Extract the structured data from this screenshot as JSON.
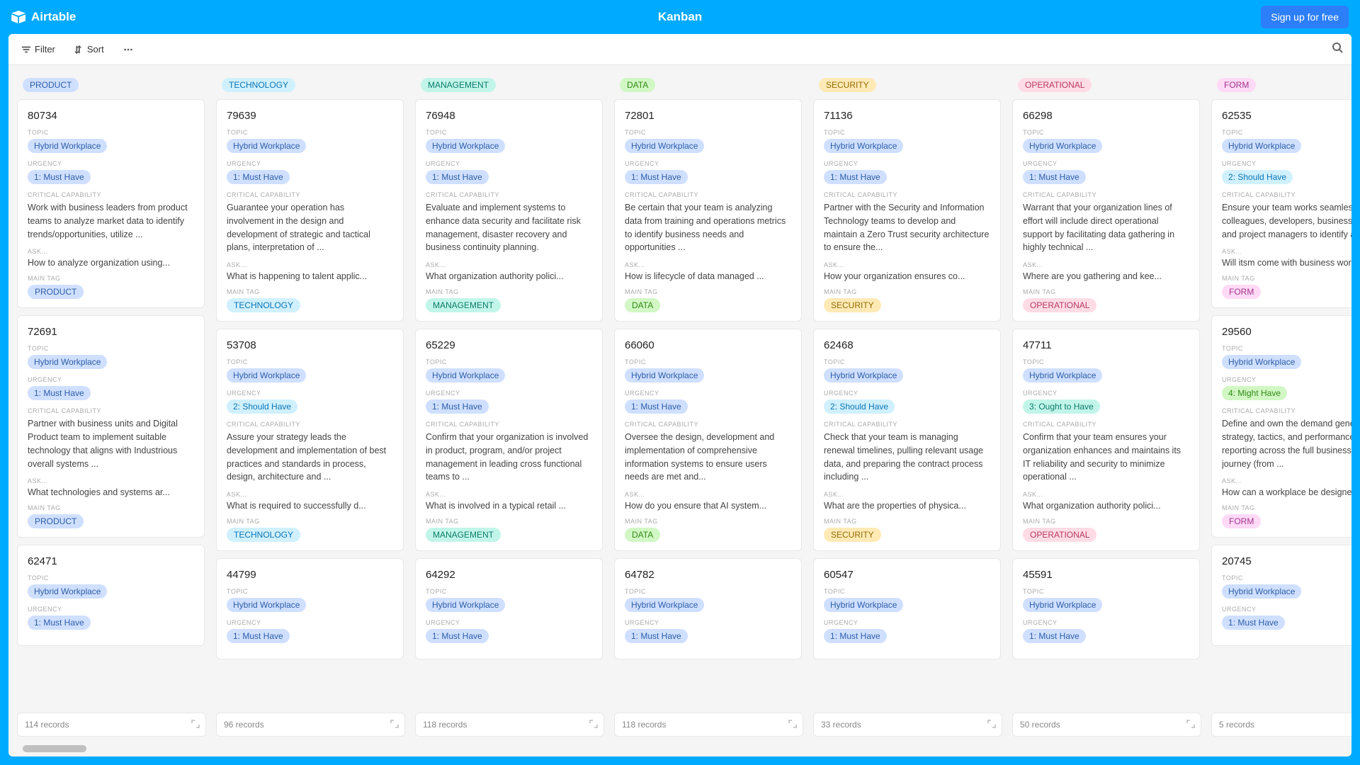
{
  "header": {
    "brand": "Airtable",
    "title": "Kanban",
    "signup": "Sign up for free"
  },
  "toolbar": {
    "filter": "Filter",
    "sort": "Sort"
  },
  "labels": {
    "topic": "TOPIC",
    "urgency": "URGENCY",
    "critical": "CRITICAL CAPABILITY",
    "ask": "ASK...",
    "maintag": "MAIN TAG"
  },
  "urgency": {
    "1": "1: Must Have",
    "2": "2: Should Have",
    "3": "3: Ought to Have",
    "4": "4: Might Have"
  },
  "columns": [
    {
      "name": "PRODUCT",
      "cls": "product",
      "records": "114 records",
      "cards": [
        {
          "id": "80734",
          "topic": "Hybrid Workplace",
          "urg": "1",
          "desc": "Work with business leaders from product teams to analyze market data to identify trends/opportunities, utilize ...",
          "ask": "How to analyze organization using..."
        },
        {
          "id": "72691",
          "topic": "Hybrid Workplace",
          "urg": "1",
          "desc": "Partner with business units and Digital Product team to implement suitable technology that aligns with Industrious overall systems ...",
          "ask": "What technologies and systems ar..."
        },
        {
          "id": "62471",
          "topic": "Hybrid Workplace",
          "urg": "1",
          "desc": "",
          "ask": ""
        }
      ]
    },
    {
      "name": "TECHNOLOGY",
      "cls": "technology",
      "records": "96 records",
      "cards": [
        {
          "id": "79639",
          "topic": "Hybrid Workplace",
          "urg": "1",
          "desc": "Guarantee your operation has involvement in the design and development of strategic and tactical plans, interpretation of ...",
          "ask": "What is happening to talent applic..."
        },
        {
          "id": "53708",
          "topic": "Hybrid Workplace",
          "urg": "2",
          "desc": "Assure your strategy leads the development and implementation of best practices and standards in process, design, architecture and ...",
          "ask": "What is required to successfully d..."
        },
        {
          "id": "44799",
          "topic": "Hybrid Workplace",
          "urg": "1",
          "desc": "",
          "ask": ""
        }
      ]
    },
    {
      "name": "MANAGEMENT",
      "cls": "management",
      "records": "118 records",
      "cards": [
        {
          "id": "76948",
          "topic": "Hybrid Workplace",
          "urg": "1",
          "desc": "Evaluate and implement systems to enhance data security and facilitate risk management, disaster recovery and business continuity planning.",
          "ask": "What organization authority polici..."
        },
        {
          "id": "65229",
          "topic": "Hybrid Workplace",
          "urg": "1",
          "desc": "Confirm that your organization is involved in product, program, and/or project management in leading cross functional teams to ...",
          "ask": "What is involved in a typical retail ..."
        },
        {
          "id": "64292",
          "topic": "Hybrid Workplace",
          "urg": "1",
          "desc": "",
          "ask": ""
        }
      ]
    },
    {
      "name": "DATA",
      "cls": "data",
      "records": "118 records",
      "cards": [
        {
          "id": "72801",
          "topic": "Hybrid Workplace",
          "urg": "1",
          "desc": "Be certain that your team is analyzing data from training and operations metrics to identify business needs and opportunities ...",
          "ask": "How is lifecycle of data managed ..."
        },
        {
          "id": "66060",
          "topic": "Hybrid Workplace",
          "urg": "1",
          "desc": "Oversee the design, development and implementation of comprehensive information systems to ensure users needs are met and...",
          "ask": "How do you ensure that AI system..."
        },
        {
          "id": "64782",
          "topic": "Hybrid Workplace",
          "urg": "1",
          "desc": "",
          "ask": ""
        }
      ]
    },
    {
      "name": "SECURITY",
      "cls": "security",
      "records": "33 records",
      "cards": [
        {
          "id": "71136",
          "topic": "Hybrid Workplace",
          "urg": "1",
          "desc": "Partner with the Security and Information Technology teams to develop and maintain a Zero Trust security architecture to ensure the...",
          "ask": "How your organization ensures co..."
        },
        {
          "id": "62468",
          "topic": "Hybrid Workplace",
          "urg": "2",
          "desc": "Check that your team is managing renewal timelines, pulling relevant usage data, and preparing the contract process including ...",
          "ask": "What are the properties of physica..."
        },
        {
          "id": "60547",
          "topic": "Hybrid Workplace",
          "urg": "1",
          "desc": "",
          "ask": ""
        }
      ]
    },
    {
      "name": "OPERATIONAL",
      "cls": "operational",
      "records": "50 records",
      "cards": [
        {
          "id": "66298",
          "topic": "Hybrid Workplace",
          "urg": "1",
          "desc": "Warrant that your organization lines of effort will include direct operational support by facilitating data gathering in highly technical ...",
          "ask": "Where are you gathering and kee..."
        },
        {
          "id": "47711",
          "topic": "Hybrid Workplace",
          "urg": "3",
          "desc": "Confirm that your team ensures your organization enhances and maintains its IT reliability and security to minimize operational ...",
          "ask": "What organization authority polici..."
        },
        {
          "id": "45591",
          "topic": "Hybrid Workplace",
          "urg": "1",
          "desc": "",
          "ask": ""
        }
      ]
    },
    {
      "name": "FORM",
      "cls": "form",
      "records": "5 records",
      "cards": [
        {
          "id": "62535",
          "topic": "Hybrid Workplace",
          "urg": "2",
          "desc": "Ensure your team works seamlessly with colleagues, developers, business analysts and project managers to identify and ...",
          "ask": "Will itsm come with business work..."
        },
        {
          "id": "29560",
          "topic": "Hybrid Workplace",
          "urg": "4",
          "desc": "Define and own the demand generation strategy, tactics, and performance reporting across the full business buyer journey (from ...",
          "ask": "How can a workplace be designed..."
        },
        {
          "id": "20745",
          "topic": "Hybrid Workplace",
          "urg": "1",
          "desc": "",
          "ask": ""
        }
      ]
    }
  ]
}
